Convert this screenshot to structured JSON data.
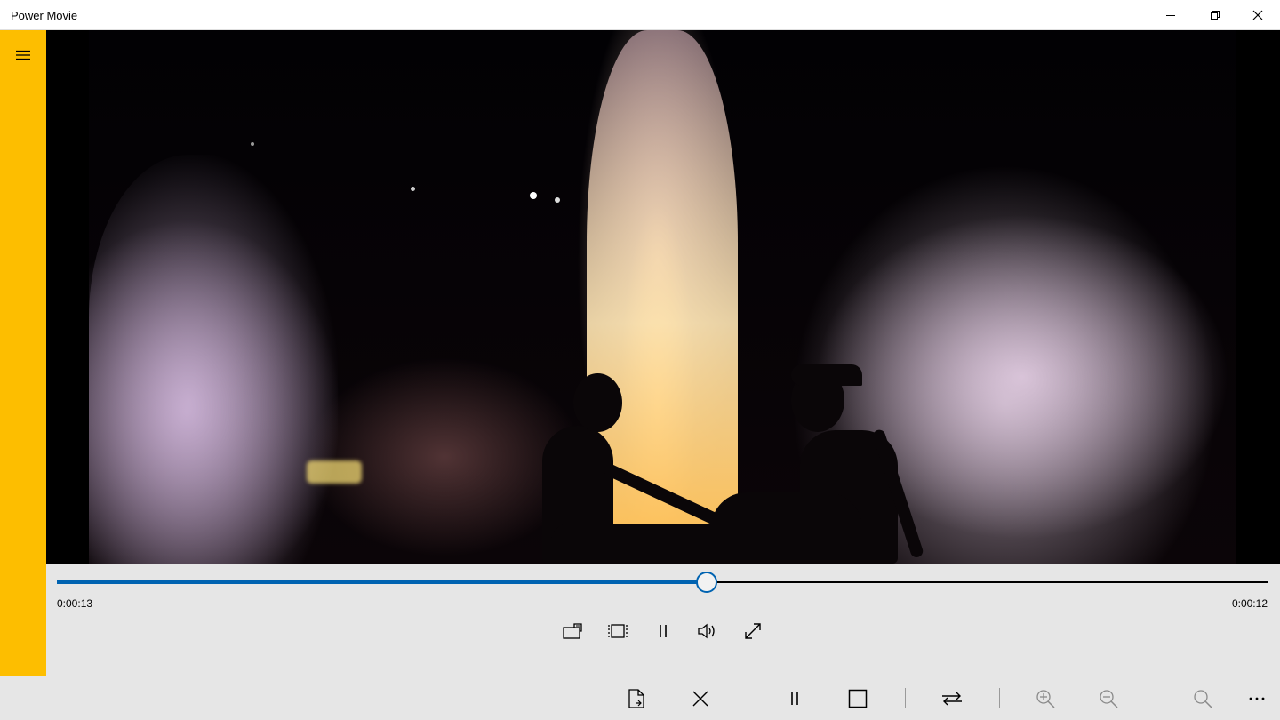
{
  "app": {
    "title": "Power Movie"
  },
  "window_controls": {
    "minimize": "minimize-icon",
    "restore": "restore-icon",
    "close": "close-icon"
  },
  "sidebar": {
    "menu_icon": "hamburger-icon",
    "accent": "#fdbe00"
  },
  "player": {
    "progress": 0.537,
    "elapsed": "0:00:13",
    "remaining": "0:00:12",
    "accent": "#0063b1"
  },
  "player_controls": [
    {
      "name": "cast-icon"
    },
    {
      "name": "aspect-ratio-icon"
    },
    {
      "name": "pause-icon"
    },
    {
      "name": "volume-icon"
    },
    {
      "name": "fullscreen-icon"
    }
  ],
  "bottom_bar": [
    {
      "name": "open-file-icon"
    },
    {
      "name": "close-icon"
    },
    {
      "name": "pause-icon"
    },
    {
      "name": "stop-icon"
    },
    {
      "name": "repeat-icon"
    },
    {
      "name": "zoom-in-icon"
    },
    {
      "name": "zoom-out-icon"
    },
    {
      "name": "search-icon"
    },
    {
      "name": "more-icon"
    }
  ]
}
